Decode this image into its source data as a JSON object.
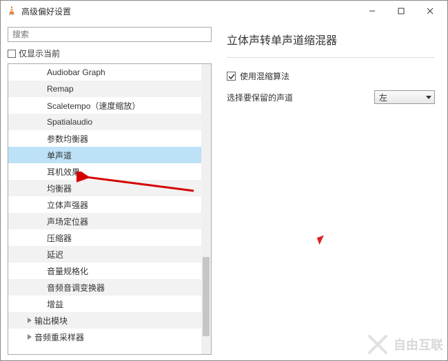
{
  "window": {
    "title": "高级偏好设置"
  },
  "left": {
    "search_placeholder": "搜索",
    "only_current_label": "仅显示当前",
    "items": [
      {
        "label": "Audiobar Graph",
        "indent": 56
      },
      {
        "label": "Remap",
        "indent": 56
      },
      {
        "label": "Scaletempo（速度缩放）",
        "indent": 56
      },
      {
        "label": "Spatialaudio",
        "indent": 56
      },
      {
        "label": "参数均衡器",
        "indent": 56
      },
      {
        "label": "单声道",
        "indent": 56,
        "selected": true
      },
      {
        "label": "耳机效果",
        "indent": 56
      },
      {
        "label": "均衡器",
        "indent": 56
      },
      {
        "label": "立体声强器",
        "indent": 56
      },
      {
        "label": "声场定位器",
        "indent": 56
      },
      {
        "label": "压缩器",
        "indent": 56
      },
      {
        "label": "延迟",
        "indent": 56
      },
      {
        "label": "音量规格化",
        "indent": 56
      },
      {
        "label": "音频音调变换器",
        "indent": 56
      },
      {
        "label": "增益",
        "indent": 56
      },
      {
        "label": "输出模块",
        "indent": 40,
        "expander": true
      },
      {
        "label": "音频重采样器",
        "indent": 40,
        "expander": true
      }
    ]
  },
  "right": {
    "title": "立体声转单声道缩混器",
    "use_algorithm_label": "使用混缩算法",
    "use_algorithm_checked": true,
    "keep_channel_label": "选择要保留的声道",
    "keep_channel_value": "左"
  },
  "watermark": {
    "text": "自由互联"
  }
}
